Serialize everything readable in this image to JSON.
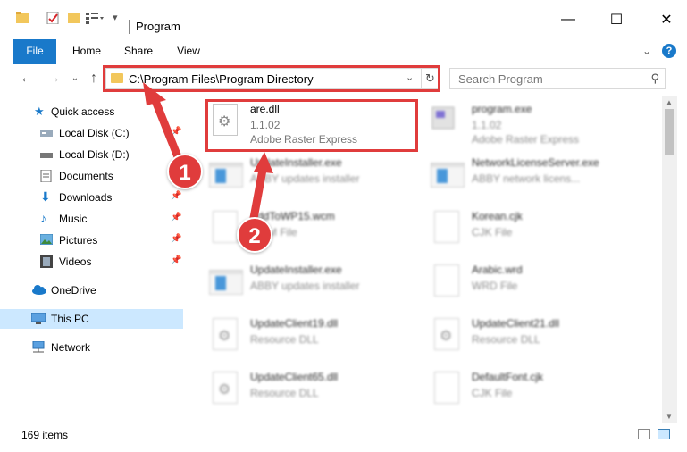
{
  "window": {
    "title": "Program"
  },
  "ribbon": {
    "tabs": [
      "File",
      "Home",
      "Share",
      "View"
    ]
  },
  "address": {
    "path": "C:\\Program Files\\Program Directory"
  },
  "search": {
    "placeholder": "Search Program"
  },
  "sidebar": {
    "items": [
      {
        "label": "Quick access",
        "icon": "star-icon"
      },
      {
        "label": "Local Disk (C:)",
        "icon": "drive-icon",
        "pinned": true
      },
      {
        "label": "Local Disk (D:)",
        "icon": "drive-icon"
      },
      {
        "label": "Documents",
        "icon": "documents-icon",
        "pinned": true
      },
      {
        "label": "Downloads",
        "icon": "downloads-icon",
        "pinned": true
      },
      {
        "label": "Music",
        "icon": "music-icon",
        "pinned": true
      },
      {
        "label": "Pictures",
        "icon": "pictures-icon",
        "pinned": true
      },
      {
        "label": "Videos",
        "icon": "videos-icon",
        "pinned": true
      },
      {
        "label": "OneDrive",
        "icon": "cloud-icon"
      },
      {
        "label": "This PC",
        "icon": "computer-icon",
        "selected": true
      },
      {
        "label": "Network",
        "icon": "network-icon"
      }
    ]
  },
  "files": [
    {
      "name": "are.dll",
      "line1": "1.1.02",
      "line2": "Adobe Raster Express",
      "type": "dll",
      "highlight": true
    },
    {
      "name": "program.exe",
      "line1": "1.1.02",
      "line2": "Adobe Raster Express",
      "type": "app"
    },
    {
      "name": "UpdateInstaller.exe",
      "line1": "ABBY updates installer",
      "line2": "",
      "type": "exe"
    },
    {
      "name": "NetworkLicenseServer.exe",
      "line1": "ABBY network licens...",
      "line2": "",
      "type": "exe"
    },
    {
      "name": "AddToWP15.wcm",
      "line1": "WCM File",
      "line2": "",
      "type": "doc"
    },
    {
      "name": "Korean.cjk",
      "line1": "CJK File",
      "line2": "",
      "type": "doc"
    },
    {
      "name": "UpdateInstaller.exe",
      "line1": "ABBY updates installer",
      "line2": "",
      "type": "exe"
    },
    {
      "name": "Arabic.wrd",
      "line1": "WRD File",
      "line2": "",
      "type": "doc"
    },
    {
      "name": "UpdateClient19.dll",
      "line1": "Resource DLL",
      "line2": "",
      "type": "dll"
    },
    {
      "name": "UpdateClient21.dll",
      "line1": "Resource DLL",
      "line2": "",
      "type": "dll"
    },
    {
      "name": "UpdateClient65.dll",
      "line1": "Resource DLL",
      "line2": "",
      "type": "dll"
    },
    {
      "name": "DefaultFont.cjk",
      "line1": "CJK File",
      "line2": "",
      "type": "doc"
    }
  ],
  "status": {
    "count": "169 items"
  },
  "annotations": [
    {
      "label": "1"
    },
    {
      "label": "2"
    }
  ],
  "colors": {
    "accent": "#1979ca",
    "highlight": "#e03c3c",
    "selected": "#cce8ff"
  }
}
